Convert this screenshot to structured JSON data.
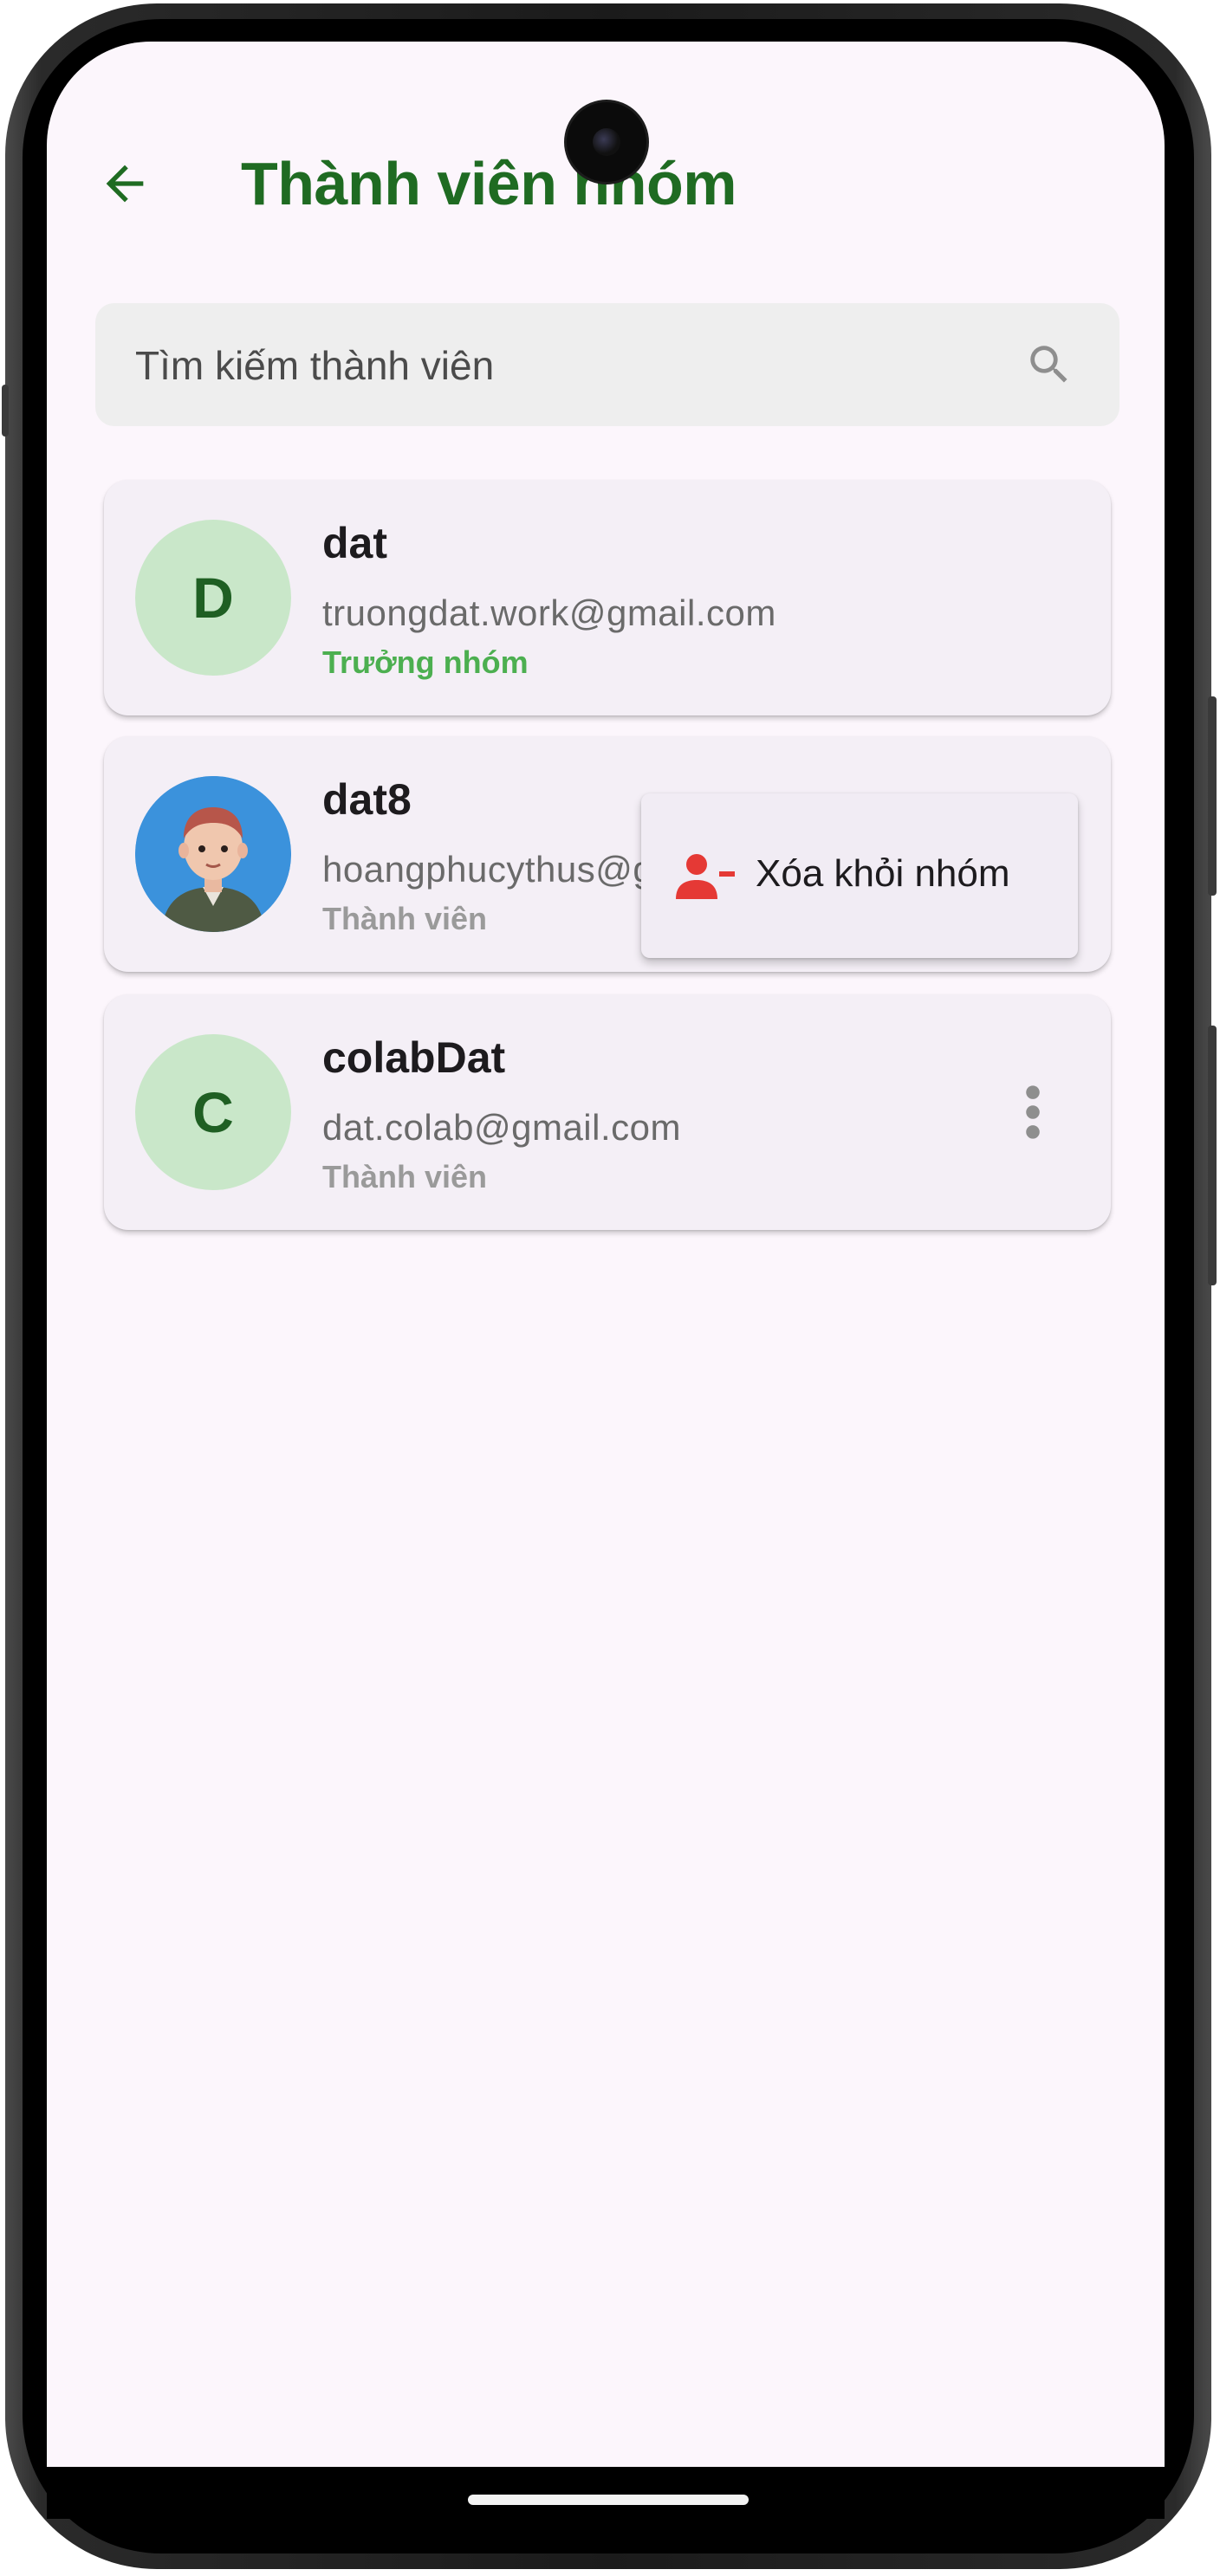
{
  "header": {
    "title": "Thành viên nhóm"
  },
  "search": {
    "placeholder": "Tìm kiếm thành viên",
    "value": ""
  },
  "members": [
    {
      "initial": "D",
      "name": "dat",
      "email": "truongdat.work@gmail.com",
      "role": "Trưởng nhóm"
    },
    {
      "initial": "",
      "name": "dat8",
      "email": "hoangphucythus@g",
      "role": "Thành viên"
    },
    {
      "initial": "C",
      "name": "colabDat",
      "email": "dat.colab@gmail.com",
      "role": "Thành viên"
    }
  ],
  "context_menu": {
    "remove_label": "Xóa khỏi nhóm"
  },
  "icons": {
    "back": "arrow-back-icon",
    "search": "search-icon",
    "more": "more-vert-icon",
    "remove": "person-remove-icon"
  },
  "colors": {
    "title": "#1f6b22",
    "leader_role": "#4caf50",
    "member_role": "#9a9a9a",
    "avatar_bg": "#c9e7c9",
    "remove_icon": "#e53935"
  }
}
